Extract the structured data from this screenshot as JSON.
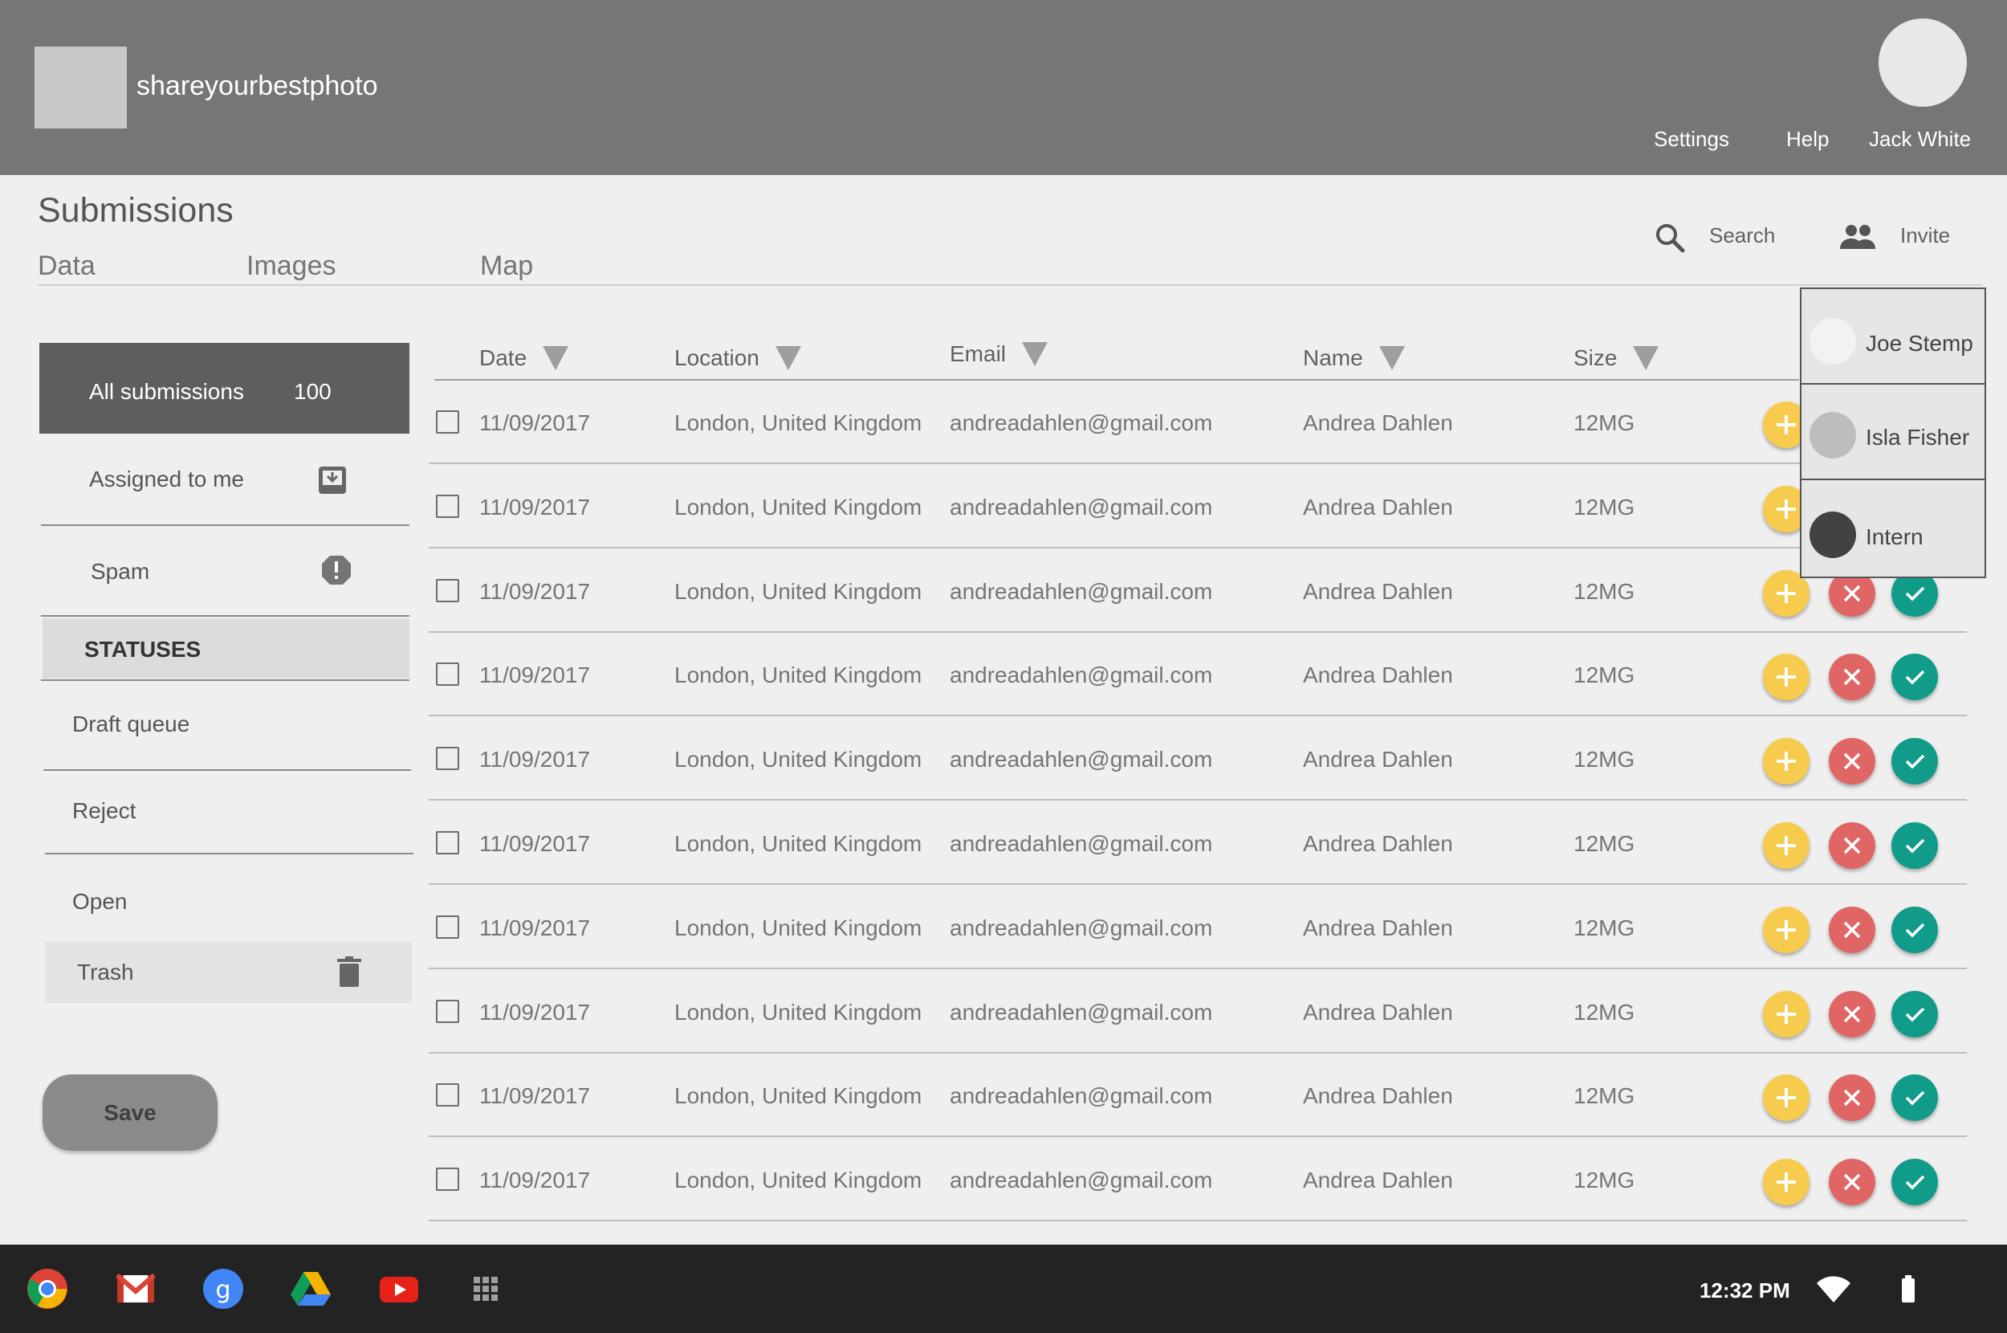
{
  "header": {
    "app_title": "shareyourbestphoto",
    "links": {
      "settings": "Settings",
      "help": "Help",
      "user": "Jack White"
    }
  },
  "page": {
    "title": "Submissions",
    "tabs": [
      "Data",
      "Images",
      "Map"
    ],
    "tools": {
      "search": "Search",
      "invite": "Invite"
    }
  },
  "sidebar": {
    "all_label": "All submissions",
    "all_count": "100",
    "assigned": "Assigned to me",
    "spam": "Spam",
    "statuses_header": "STATUSES",
    "statuses": [
      "Draft queue",
      "Reject",
      "Open",
      "Trash"
    ],
    "save": "Save"
  },
  "table": {
    "columns": [
      "Date",
      "Location",
      "Email",
      "Name",
      "Size"
    ],
    "rows": [
      [
        "11/09/2017",
        "London, United Kingdom",
        "andreadahlen@gmail.com",
        "Andrea Dahlen",
        "12MG"
      ],
      [
        "11/09/2017",
        "London, United Kingdom",
        "andreadahlen@gmail.com",
        "Andrea Dahlen",
        "12MG"
      ],
      [
        "11/09/2017",
        "London, United Kingdom",
        "andreadahlen@gmail.com",
        "Andrea Dahlen",
        "12MG"
      ],
      [
        "11/09/2017",
        "London, United Kingdom",
        "andreadahlen@gmail.com",
        "Andrea Dahlen",
        "12MG"
      ],
      [
        "11/09/2017",
        "London, United Kingdom",
        "andreadahlen@gmail.com",
        "Andrea Dahlen",
        "12MG"
      ],
      [
        "11/09/2017",
        "London, United Kingdom",
        "andreadahlen@gmail.com",
        "Andrea Dahlen",
        "12MG"
      ],
      [
        "11/09/2017",
        "London, United Kingdom",
        "andreadahlen@gmail.com",
        "Andrea Dahlen",
        "12MG"
      ],
      [
        "11/09/2017",
        "London, United Kingdom",
        "andreadahlen@gmail.com",
        "Andrea Dahlen",
        "12MG"
      ],
      [
        "11/09/2017",
        "London, United Kingdom",
        "andreadahlen@gmail.com",
        "Andrea Dahlen",
        "12MG"
      ],
      [
        "11/09/2017",
        "London, United Kingdom",
        "andreadahlen@gmail.com",
        "Andrea Dahlen",
        "12MG"
      ]
    ]
  },
  "invite_popup": {
    "people": [
      {
        "name": "Joe Stemp",
        "avatar_color": "#eeeeee"
      },
      {
        "name": "Isla Fisher",
        "avatar_color": "#bdbdbd"
      },
      {
        "name": "Intern",
        "avatar_color": "#424242"
      }
    ]
  },
  "taskbar": {
    "clock": "12:32 PM",
    "apps": [
      "chrome-icon",
      "gmail-icon",
      "google-plus-icon",
      "drive-icon",
      "youtube-icon",
      "app-launcher-icon"
    ]
  },
  "colors": {
    "header_bg": "#767676",
    "add_button": "#f7cb4d",
    "reject_button": "#e06666",
    "accept_button": "#119c8a"
  }
}
